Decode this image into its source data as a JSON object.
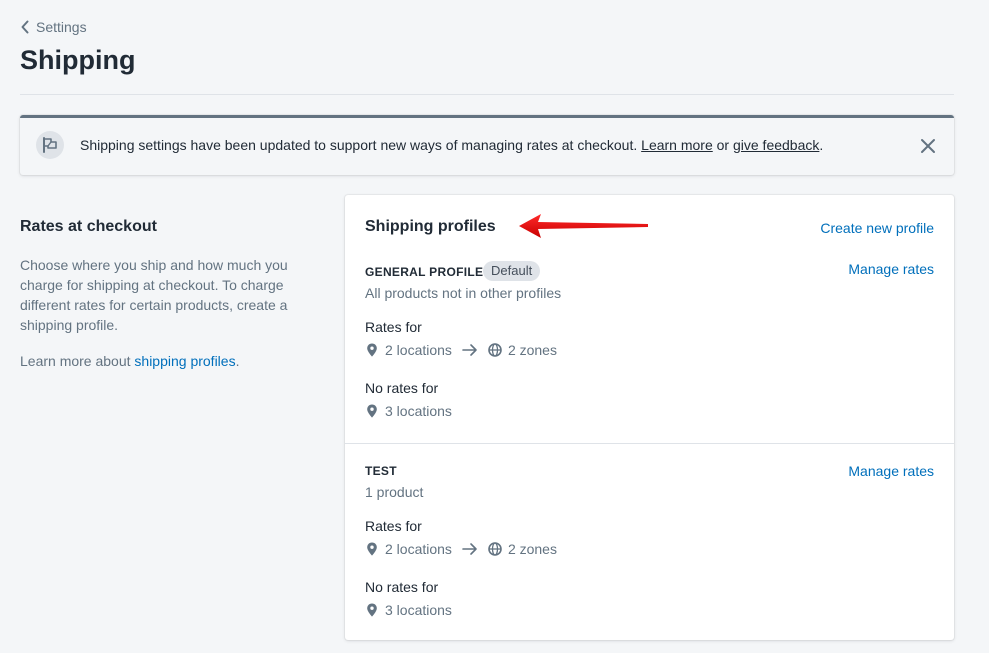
{
  "breadcrumb": {
    "back_label": "Settings"
  },
  "page": {
    "title": "Shipping"
  },
  "banner": {
    "text": "Shipping settings have been updated to support new ways of managing rates at checkout.",
    "learn_more": "Learn more",
    "or": "or",
    "feedback": "give feedback",
    "end": ".",
    "icon": "flag-icon",
    "close_icon": "close-icon"
  },
  "section": {
    "title": "Rates at checkout",
    "description": "Choose where you ship and how much you charge for shipping at checkout. To charge different rates for certain products, create a shipping profile.",
    "learn_prefix": "Learn more about ",
    "learn_link": "shipping profiles",
    "learn_suffix": "."
  },
  "card": {
    "title": "Shipping profiles",
    "create_label": "Create new profile",
    "profiles": [
      {
        "name": "GENERAL PROFILE",
        "badge": "Default",
        "subtitle": "All products not in other profiles",
        "manage_label": "Manage rates",
        "rates_for_label": "Rates for",
        "rates_locations": "2 locations",
        "rates_zones": "2 zones",
        "no_rates_label": "No rates for",
        "no_rates_locations": "3 locations"
      },
      {
        "name": "TEST",
        "subtitle": "1 product",
        "manage_label": "Manage rates",
        "rates_for_label": "Rates for",
        "rates_locations": "2 locations",
        "rates_zones": "2 zones",
        "no_rates_label": "No rates for",
        "no_rates_locations": "3 locations"
      }
    ]
  },
  "annotation": {
    "arrow_color": "#e00000"
  },
  "colors": {
    "link": "#006fbb",
    "banner_border": "#637381",
    "background": "#f4f6f8"
  }
}
